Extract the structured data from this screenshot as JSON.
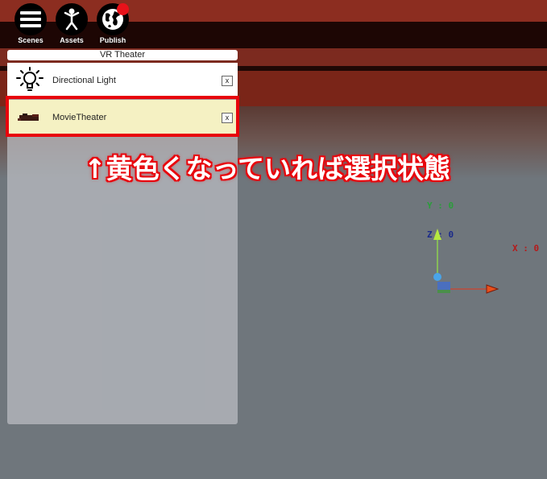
{
  "toolbar": {
    "buttons": [
      {
        "label": "Scenes",
        "icon": "menu-icon"
      },
      {
        "label": "Assets",
        "icon": "person-icon"
      },
      {
        "label": "Publish",
        "icon": "globe-icon"
      }
    ]
  },
  "panel": {
    "title": "VR Theater",
    "items": [
      {
        "label": "Directional Light",
        "icon": "lightbulb-icon",
        "close": "x",
        "selected": false
      },
      {
        "label": "MovieTheater",
        "icon": "theater-model-icon",
        "close": "x",
        "selected": true
      }
    ]
  },
  "annotation": "↑黄色くなっていれば選択状態",
  "gizmo": {
    "y_label": "Y : 0",
    "z_label": "Z : 0",
    "x_label": "X : 0",
    "colors": {
      "y": "#2a9d3a",
      "z": "#1a2a8a",
      "x": "#b51a1a",
      "accent": "#e8050c",
      "selected_row": "#f5f1c3"
    }
  }
}
